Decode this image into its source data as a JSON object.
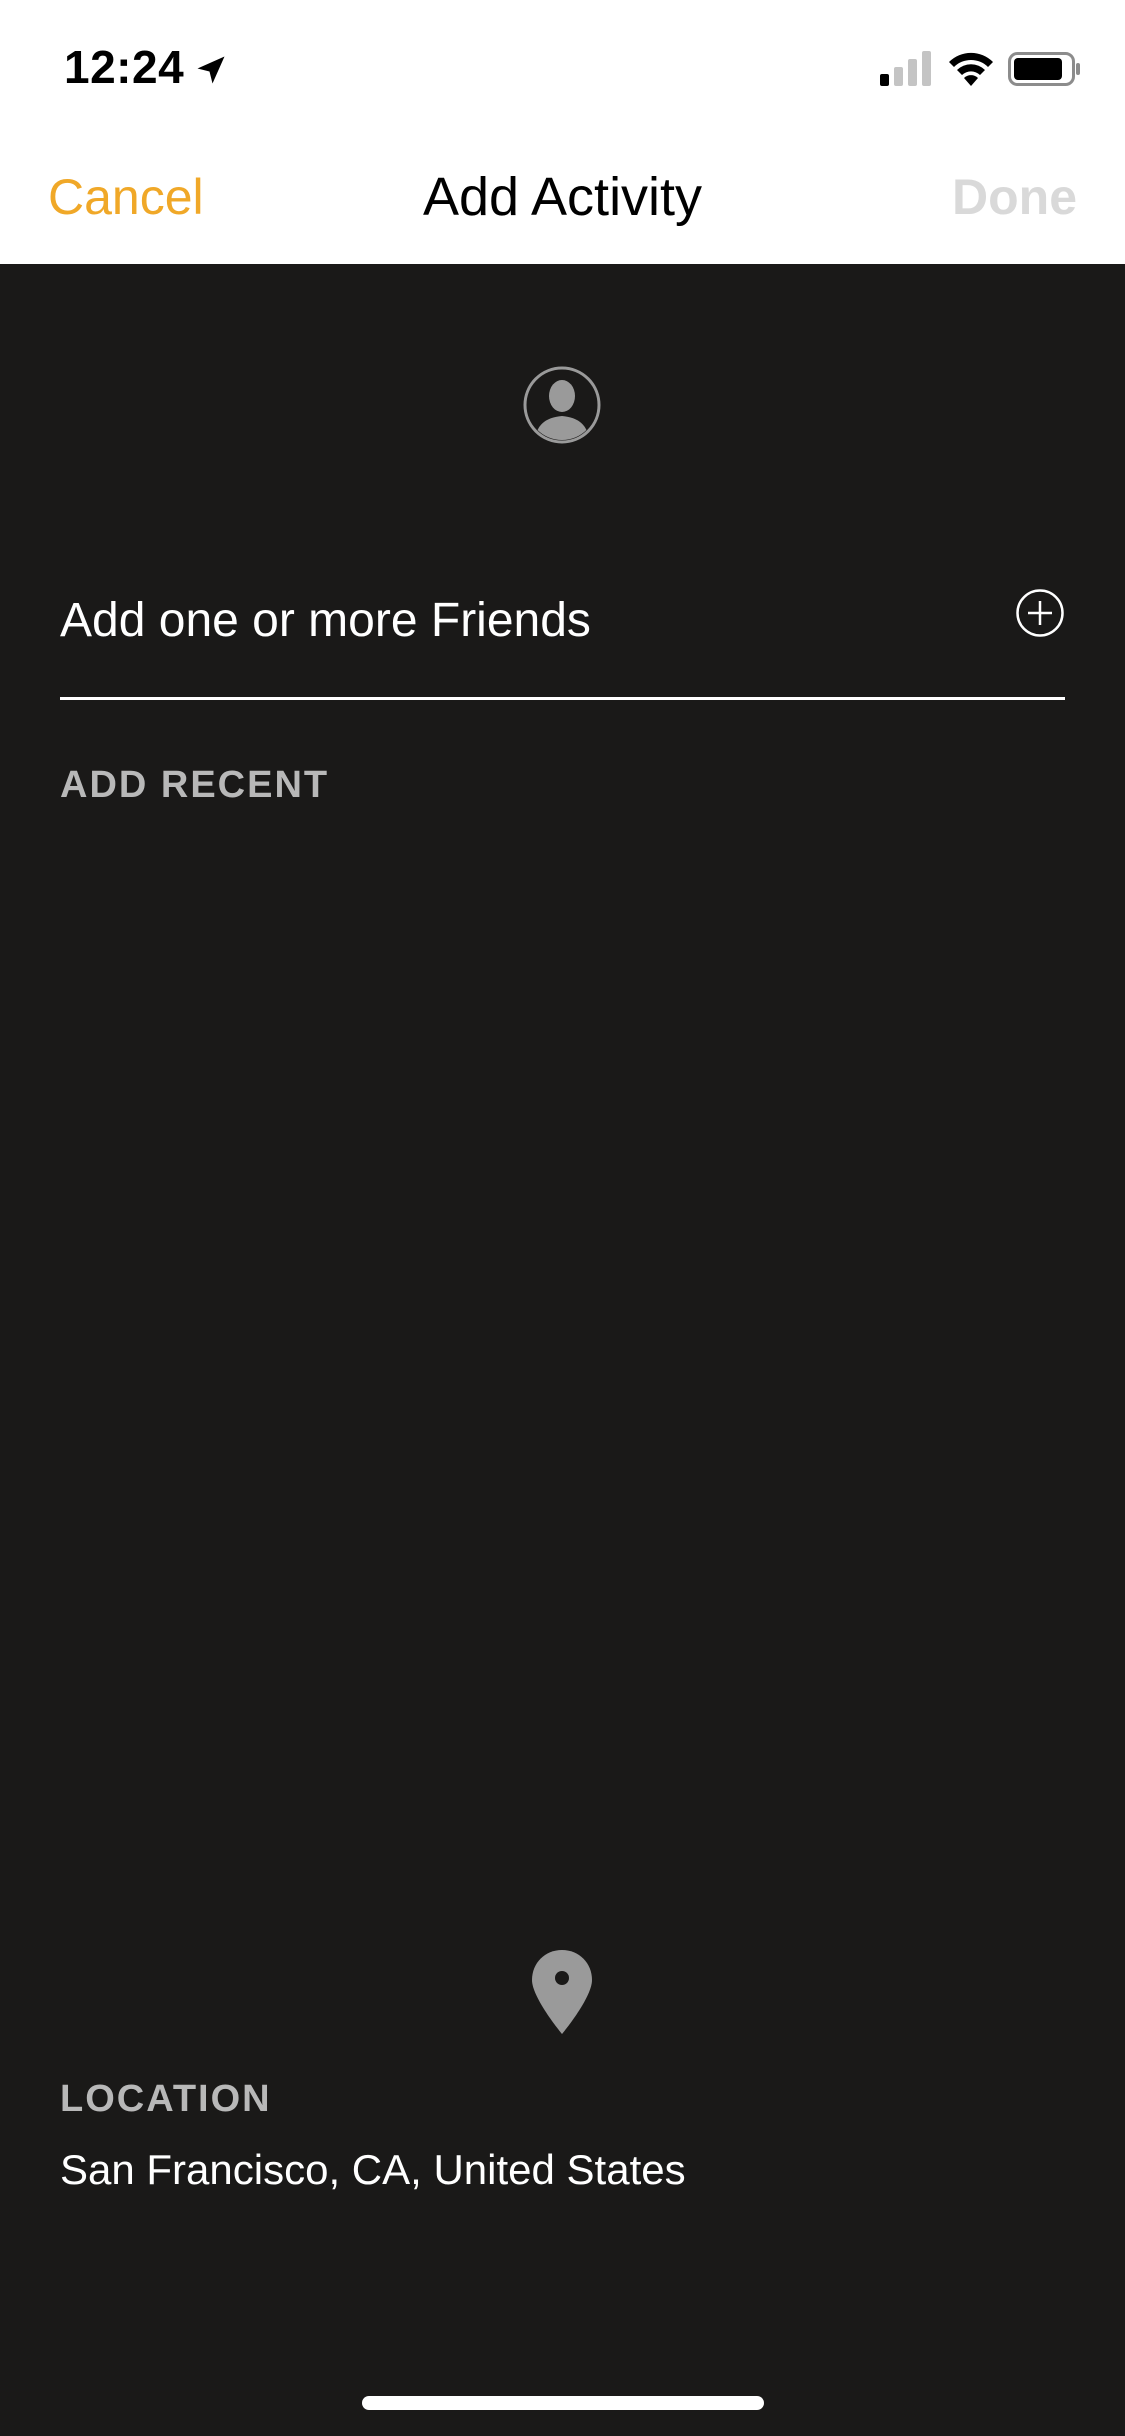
{
  "status_bar": {
    "time": "12:24",
    "icons": [
      "location-arrow-icon",
      "cellular-signal-icon",
      "wifi-icon",
      "battery-icon"
    ]
  },
  "nav": {
    "cancel_label": "Cancel",
    "title": "Add Activity",
    "done_label": "Done",
    "accent_color": "#f0a828",
    "done_disabled_color": "#d9d9d9"
  },
  "friends": {
    "avatar_icon": "person-avatar-icon",
    "placeholder": "Add one or more Friends",
    "value": "",
    "add_icon": "plus-circle-icon"
  },
  "recent": {
    "heading": "ADD RECENT"
  },
  "location": {
    "icon": "map-pin-icon",
    "heading": "LOCATION",
    "value": "San Francisco, CA, United States"
  },
  "colors": {
    "background": "#1a1918",
    "top_background": "#ffffff",
    "section_label": "#b8b8b8"
  }
}
